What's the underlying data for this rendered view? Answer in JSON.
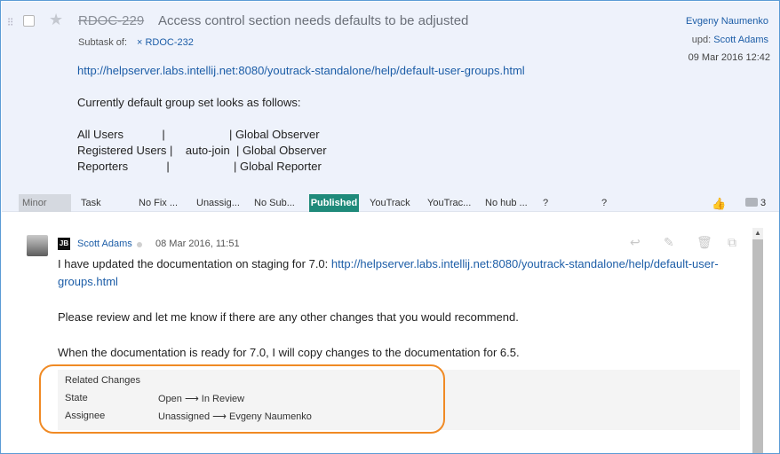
{
  "issue": {
    "drag_handle": "⁝⁝",
    "star": "★",
    "id": "RDOC-229",
    "summary": "Access control section needs defaults to be adjusted",
    "subtask_label": "Subtask of:",
    "subtask_link": "× RDOC-232",
    "author": "Evgeny Naumenko",
    "updated_prefix": "upd:",
    "updated_by": "Scott Adams",
    "date": "09 Mar 2016 12:42",
    "description_link": "http://helpserver.labs.intellij.net:8080/youtrack-standalone/help/default-user-groups.html",
    "description_line": "Currently default group set looks as follows:",
    "groups": [
      "All Users            |                    | Global Observer",
      "Registered Users |    auto-join  | Global Observer",
      "Reporters            |                    | Global Reporter"
    ]
  },
  "fields": {
    "priority": "Minor",
    "type": "Task",
    "fix_version": "No Fix ...",
    "assignee": "Unassig...",
    "subsystem": "No Sub...",
    "state": "Published",
    "product": "YouTrack",
    "product2": "YouTrac...",
    "hub": "No hub ...",
    "unknown1": "?",
    "unknown2": "?",
    "comments_count": "3"
  },
  "comment": {
    "badge": "JB",
    "author": "Scott Adams",
    "date": "08 Mar 2016, 11:51",
    "text_1_prefix": "I have updated the documentation on staging for 7.0:",
    "text_1_link_a": "http://helpserver.labs.intellij.net:8080/youtrack-standalone/help/default-user-",
    "text_1_link_b": "groups.html",
    "text_2": "Please review and let me know if there are any other changes that you would recommend.",
    "text_3": "When the documentation is ready for 7.0, I will copy changes to the documentation for 6.5.",
    "changes": {
      "title": "Related Changes",
      "state_label": "State",
      "state_value": "Open ⟶ In Review",
      "assignee_label": "Assignee",
      "assignee_value": "Unassigned ⟶ Evgeny Naumenko"
    }
  },
  "icons": {
    "reply": "↩",
    "edit": "✎",
    "delete": "🗑",
    "open": "⧉",
    "thumb": "👍",
    "scroll_up": "▲"
  },
  "colors": {
    "accent_link": "#1c5da7",
    "published_badge": "#1f8a7a",
    "highlight": "#f08a24",
    "panel_bg": "#eef2fb"
  }
}
